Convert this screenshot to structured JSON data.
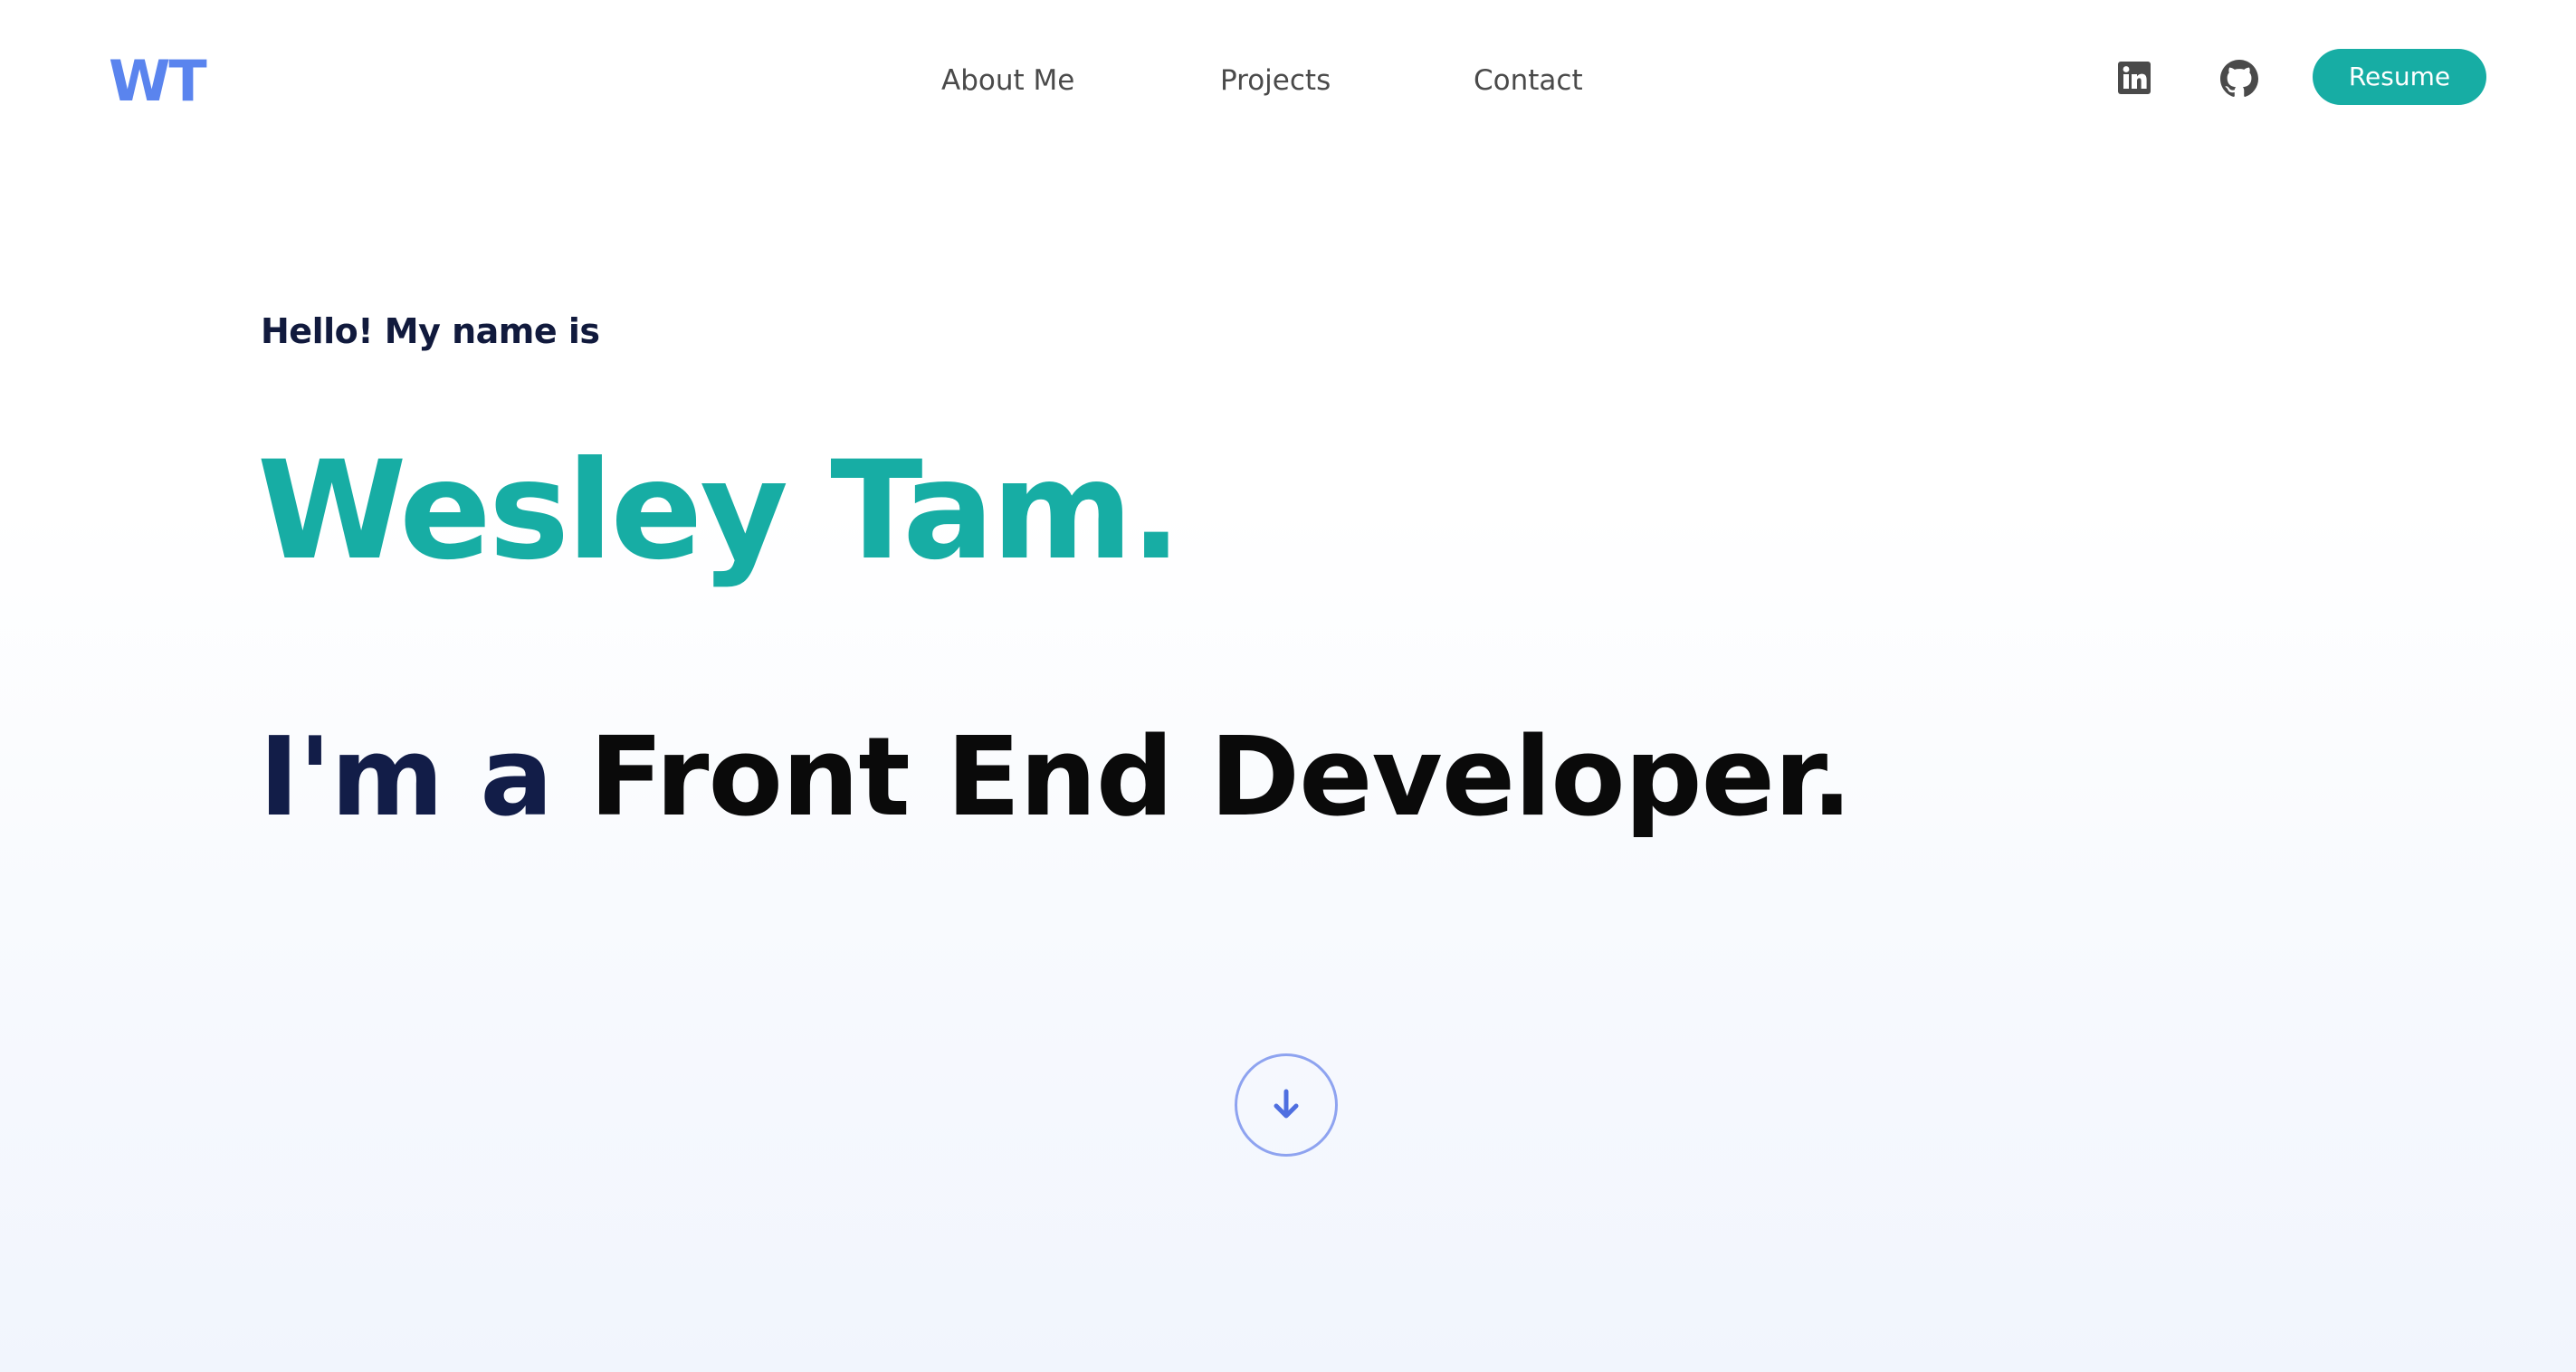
{
  "header": {
    "logo": "WT",
    "nav": [
      {
        "label": "About Me"
      },
      {
        "label": "Projects"
      },
      {
        "label": "Contact"
      }
    ],
    "social": [
      {
        "icon": "linkedin-icon"
      },
      {
        "icon": "github-icon"
      }
    ],
    "resume_label": "Resume"
  },
  "hero": {
    "greeting": "Hello! My name is",
    "name": "Wesley Tam.",
    "role_prefix": "I'm a",
    "role_title": "Front End Developer."
  },
  "scroll": {
    "icon": "arrow-down-icon"
  },
  "colors": {
    "logo": "#5a84ee",
    "accent": "#17ada4",
    "navy": "#121d48",
    "scroll_ring": "#8ea3f0"
  }
}
